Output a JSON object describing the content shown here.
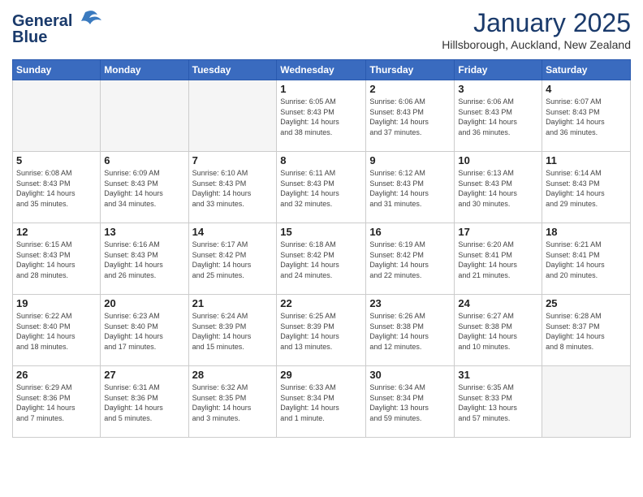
{
  "header": {
    "logo_line1": "General",
    "logo_line2": "Blue",
    "month": "January 2025",
    "location": "Hillsborough, Auckland, New Zealand"
  },
  "weekdays": [
    "Sunday",
    "Monday",
    "Tuesday",
    "Wednesday",
    "Thursday",
    "Friday",
    "Saturday"
  ],
  "weeks": [
    [
      {
        "day": "",
        "info": ""
      },
      {
        "day": "",
        "info": ""
      },
      {
        "day": "",
        "info": ""
      },
      {
        "day": "1",
        "info": "Sunrise: 6:05 AM\nSunset: 8:43 PM\nDaylight: 14 hours\nand 38 minutes."
      },
      {
        "day": "2",
        "info": "Sunrise: 6:06 AM\nSunset: 8:43 PM\nDaylight: 14 hours\nand 37 minutes."
      },
      {
        "day": "3",
        "info": "Sunrise: 6:06 AM\nSunset: 8:43 PM\nDaylight: 14 hours\nand 36 minutes."
      },
      {
        "day": "4",
        "info": "Sunrise: 6:07 AM\nSunset: 8:43 PM\nDaylight: 14 hours\nand 36 minutes."
      }
    ],
    [
      {
        "day": "5",
        "info": "Sunrise: 6:08 AM\nSunset: 8:43 PM\nDaylight: 14 hours\nand 35 minutes."
      },
      {
        "day": "6",
        "info": "Sunrise: 6:09 AM\nSunset: 8:43 PM\nDaylight: 14 hours\nand 34 minutes."
      },
      {
        "day": "7",
        "info": "Sunrise: 6:10 AM\nSunset: 8:43 PM\nDaylight: 14 hours\nand 33 minutes."
      },
      {
        "day": "8",
        "info": "Sunrise: 6:11 AM\nSunset: 8:43 PM\nDaylight: 14 hours\nand 32 minutes."
      },
      {
        "day": "9",
        "info": "Sunrise: 6:12 AM\nSunset: 8:43 PM\nDaylight: 14 hours\nand 31 minutes."
      },
      {
        "day": "10",
        "info": "Sunrise: 6:13 AM\nSunset: 8:43 PM\nDaylight: 14 hours\nand 30 minutes."
      },
      {
        "day": "11",
        "info": "Sunrise: 6:14 AM\nSunset: 8:43 PM\nDaylight: 14 hours\nand 29 minutes."
      }
    ],
    [
      {
        "day": "12",
        "info": "Sunrise: 6:15 AM\nSunset: 8:43 PM\nDaylight: 14 hours\nand 28 minutes."
      },
      {
        "day": "13",
        "info": "Sunrise: 6:16 AM\nSunset: 8:43 PM\nDaylight: 14 hours\nand 26 minutes."
      },
      {
        "day": "14",
        "info": "Sunrise: 6:17 AM\nSunset: 8:42 PM\nDaylight: 14 hours\nand 25 minutes."
      },
      {
        "day": "15",
        "info": "Sunrise: 6:18 AM\nSunset: 8:42 PM\nDaylight: 14 hours\nand 24 minutes."
      },
      {
        "day": "16",
        "info": "Sunrise: 6:19 AM\nSunset: 8:42 PM\nDaylight: 14 hours\nand 22 minutes."
      },
      {
        "day": "17",
        "info": "Sunrise: 6:20 AM\nSunset: 8:41 PM\nDaylight: 14 hours\nand 21 minutes."
      },
      {
        "day": "18",
        "info": "Sunrise: 6:21 AM\nSunset: 8:41 PM\nDaylight: 14 hours\nand 20 minutes."
      }
    ],
    [
      {
        "day": "19",
        "info": "Sunrise: 6:22 AM\nSunset: 8:40 PM\nDaylight: 14 hours\nand 18 minutes."
      },
      {
        "day": "20",
        "info": "Sunrise: 6:23 AM\nSunset: 8:40 PM\nDaylight: 14 hours\nand 17 minutes."
      },
      {
        "day": "21",
        "info": "Sunrise: 6:24 AM\nSunset: 8:39 PM\nDaylight: 14 hours\nand 15 minutes."
      },
      {
        "day": "22",
        "info": "Sunrise: 6:25 AM\nSunset: 8:39 PM\nDaylight: 14 hours\nand 13 minutes."
      },
      {
        "day": "23",
        "info": "Sunrise: 6:26 AM\nSunset: 8:38 PM\nDaylight: 14 hours\nand 12 minutes."
      },
      {
        "day": "24",
        "info": "Sunrise: 6:27 AM\nSunset: 8:38 PM\nDaylight: 14 hours\nand 10 minutes."
      },
      {
        "day": "25",
        "info": "Sunrise: 6:28 AM\nSunset: 8:37 PM\nDaylight: 14 hours\nand 8 minutes."
      }
    ],
    [
      {
        "day": "26",
        "info": "Sunrise: 6:29 AM\nSunset: 8:36 PM\nDaylight: 14 hours\nand 7 minutes."
      },
      {
        "day": "27",
        "info": "Sunrise: 6:31 AM\nSunset: 8:36 PM\nDaylight: 14 hours\nand 5 minutes."
      },
      {
        "day": "28",
        "info": "Sunrise: 6:32 AM\nSunset: 8:35 PM\nDaylight: 14 hours\nand 3 minutes."
      },
      {
        "day": "29",
        "info": "Sunrise: 6:33 AM\nSunset: 8:34 PM\nDaylight: 14 hours\nand 1 minute."
      },
      {
        "day": "30",
        "info": "Sunrise: 6:34 AM\nSunset: 8:34 PM\nDaylight: 13 hours\nand 59 minutes."
      },
      {
        "day": "31",
        "info": "Sunrise: 6:35 AM\nSunset: 8:33 PM\nDaylight: 13 hours\nand 57 minutes."
      },
      {
        "day": "",
        "info": ""
      }
    ]
  ]
}
